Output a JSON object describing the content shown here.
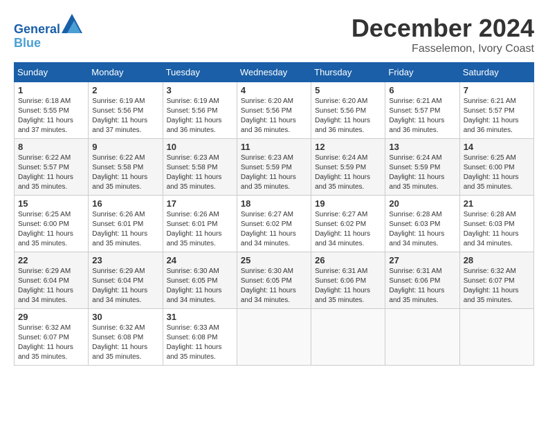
{
  "header": {
    "logo_line1": "General",
    "logo_line2": "Blue",
    "month": "December 2024",
    "location": "Fasselemon, Ivory Coast"
  },
  "weekdays": [
    "Sunday",
    "Monday",
    "Tuesday",
    "Wednesday",
    "Thursday",
    "Friday",
    "Saturday"
  ],
  "weeks": [
    [
      {
        "day": "1",
        "sunrise": "6:18 AM",
        "sunset": "5:55 PM",
        "daylight": "11 hours and 37 minutes."
      },
      {
        "day": "2",
        "sunrise": "6:19 AM",
        "sunset": "5:56 PM",
        "daylight": "11 hours and 37 minutes."
      },
      {
        "day": "3",
        "sunrise": "6:19 AM",
        "sunset": "5:56 PM",
        "daylight": "11 hours and 36 minutes."
      },
      {
        "day": "4",
        "sunrise": "6:20 AM",
        "sunset": "5:56 PM",
        "daylight": "11 hours and 36 minutes."
      },
      {
        "day": "5",
        "sunrise": "6:20 AM",
        "sunset": "5:56 PM",
        "daylight": "11 hours and 36 minutes."
      },
      {
        "day": "6",
        "sunrise": "6:21 AM",
        "sunset": "5:57 PM",
        "daylight": "11 hours and 36 minutes."
      },
      {
        "day": "7",
        "sunrise": "6:21 AM",
        "sunset": "5:57 PM",
        "daylight": "11 hours and 36 minutes."
      }
    ],
    [
      {
        "day": "8",
        "sunrise": "6:22 AM",
        "sunset": "5:57 PM",
        "daylight": "11 hours and 35 minutes."
      },
      {
        "day": "9",
        "sunrise": "6:22 AM",
        "sunset": "5:58 PM",
        "daylight": "11 hours and 35 minutes."
      },
      {
        "day": "10",
        "sunrise": "6:23 AM",
        "sunset": "5:58 PM",
        "daylight": "11 hours and 35 minutes."
      },
      {
        "day": "11",
        "sunrise": "6:23 AM",
        "sunset": "5:59 PM",
        "daylight": "11 hours and 35 minutes."
      },
      {
        "day": "12",
        "sunrise": "6:24 AM",
        "sunset": "5:59 PM",
        "daylight": "11 hours and 35 minutes."
      },
      {
        "day": "13",
        "sunrise": "6:24 AM",
        "sunset": "5:59 PM",
        "daylight": "11 hours and 35 minutes."
      },
      {
        "day": "14",
        "sunrise": "6:25 AM",
        "sunset": "6:00 PM",
        "daylight": "11 hours and 35 minutes."
      }
    ],
    [
      {
        "day": "15",
        "sunrise": "6:25 AM",
        "sunset": "6:00 PM",
        "daylight": "11 hours and 35 minutes."
      },
      {
        "day": "16",
        "sunrise": "6:26 AM",
        "sunset": "6:01 PM",
        "daylight": "11 hours and 35 minutes."
      },
      {
        "day": "17",
        "sunrise": "6:26 AM",
        "sunset": "6:01 PM",
        "daylight": "11 hours and 35 minutes."
      },
      {
        "day": "18",
        "sunrise": "6:27 AM",
        "sunset": "6:02 PM",
        "daylight": "11 hours and 34 minutes."
      },
      {
        "day": "19",
        "sunrise": "6:27 AM",
        "sunset": "6:02 PM",
        "daylight": "11 hours and 34 minutes."
      },
      {
        "day": "20",
        "sunrise": "6:28 AM",
        "sunset": "6:03 PM",
        "daylight": "11 hours and 34 minutes."
      },
      {
        "day": "21",
        "sunrise": "6:28 AM",
        "sunset": "6:03 PM",
        "daylight": "11 hours and 34 minutes."
      }
    ],
    [
      {
        "day": "22",
        "sunrise": "6:29 AM",
        "sunset": "6:04 PM",
        "daylight": "11 hours and 34 minutes."
      },
      {
        "day": "23",
        "sunrise": "6:29 AM",
        "sunset": "6:04 PM",
        "daylight": "11 hours and 34 minutes."
      },
      {
        "day": "24",
        "sunrise": "6:30 AM",
        "sunset": "6:05 PM",
        "daylight": "11 hours and 34 minutes."
      },
      {
        "day": "25",
        "sunrise": "6:30 AM",
        "sunset": "6:05 PM",
        "daylight": "11 hours and 34 minutes."
      },
      {
        "day": "26",
        "sunrise": "6:31 AM",
        "sunset": "6:06 PM",
        "daylight": "11 hours and 35 minutes."
      },
      {
        "day": "27",
        "sunrise": "6:31 AM",
        "sunset": "6:06 PM",
        "daylight": "11 hours and 35 minutes."
      },
      {
        "day": "28",
        "sunrise": "6:32 AM",
        "sunset": "6:07 PM",
        "daylight": "11 hours and 35 minutes."
      }
    ],
    [
      {
        "day": "29",
        "sunrise": "6:32 AM",
        "sunset": "6:07 PM",
        "daylight": "11 hours and 35 minutes."
      },
      {
        "day": "30",
        "sunrise": "6:32 AM",
        "sunset": "6:08 PM",
        "daylight": "11 hours and 35 minutes."
      },
      {
        "day": "31",
        "sunrise": "6:33 AM",
        "sunset": "6:08 PM",
        "daylight": "11 hours and 35 minutes."
      },
      null,
      null,
      null,
      null
    ]
  ]
}
